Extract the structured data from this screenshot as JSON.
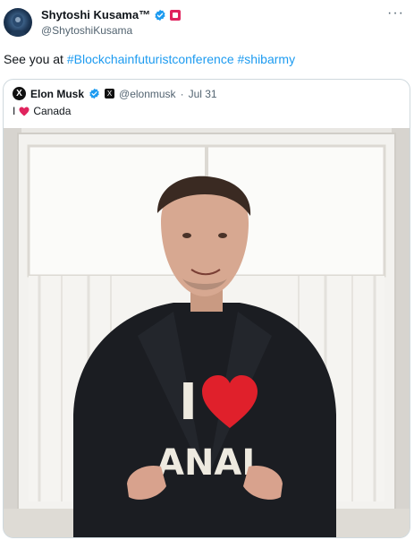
{
  "author": {
    "display_name": "Shytoshi Kusama™",
    "handle": "@ShytoshiKusama",
    "avatar_icon": "avatar-image"
  },
  "more_label": "···",
  "tweet": {
    "text_prefix": "See you at ",
    "hashtags": [
      "#Blockchainfuturistconference",
      "#shibarmy"
    ]
  },
  "quote": {
    "display_name": "Elon Musk",
    "handle": "@elonmusk",
    "separator": "·",
    "date": "Jul 31",
    "text_prefix": "I",
    "text_suffix": "Canada",
    "shirt_text_top": "I",
    "shirt_text_bottom": "ANAI"
  },
  "colors": {
    "link": "#1d9bf0",
    "verified": "#1d9bf0",
    "heart": "#e0245e",
    "text": "#0f1419",
    "secondary": "#536471",
    "border": "#cfd9de"
  }
}
